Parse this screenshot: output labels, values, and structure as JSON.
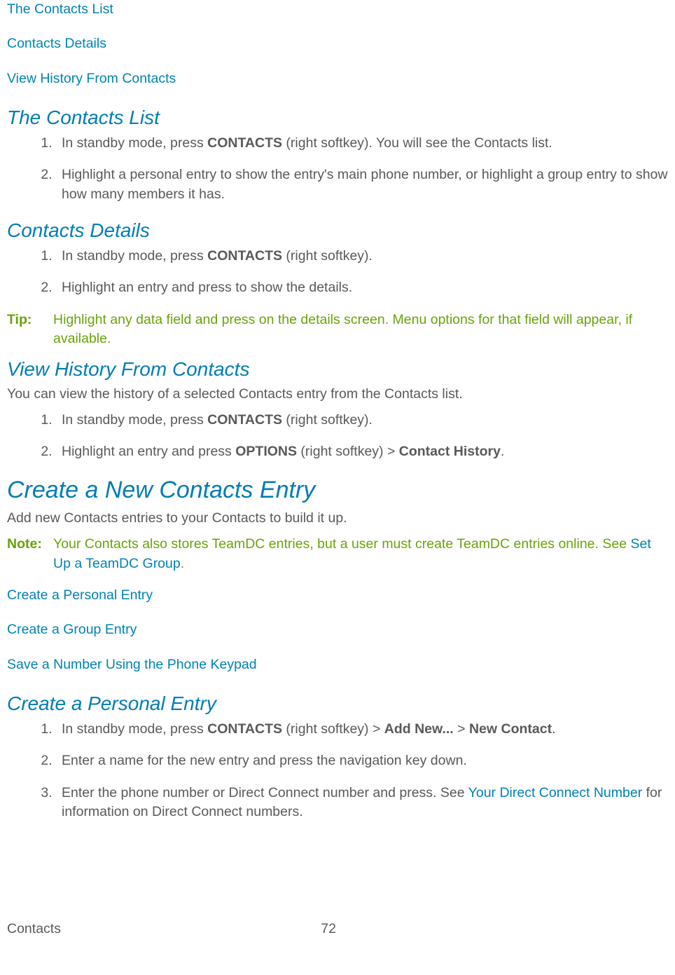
{
  "toc1": {
    "item1": "The Contacts List",
    "item2": "Contacts Details",
    "item3": "View History From Contacts"
  },
  "section1": {
    "heading": "The Contacts List",
    "li1_a": "In standby mode, press ",
    "li1_b": "CONTACTS",
    "li1_c": " (right softkey). You will see the Contacts list.",
    "li2": "Highlight a personal entry to show the entry's main phone number, or highlight a group entry to show how many members it has."
  },
  "section2": {
    "heading": "Contacts Details",
    "li1_a": "In standby mode, press ",
    "li1_b": "CONTACTS",
    "li1_c": " (right softkey).",
    "li2": "Highlight an entry and press  to show the details."
  },
  "tip": {
    "label": "Tip:",
    "text": "Highlight any data field and press  on the details screen. Menu options for that field will appear, if available."
  },
  "section3": {
    "heading": "View History From Contacts",
    "intro": "You can view the history of a selected Contacts entry from the Contacts list.",
    "li1_a": "In standby mode, press ",
    "li1_b": "CONTACTS",
    "li1_c": " (right softkey).",
    "li2_a": "Highlight an entry and press ",
    "li2_b": "OPTIONS",
    "li2_c": " (right softkey) > ",
    "li2_d": "Contact History",
    "li2_e": "."
  },
  "section4": {
    "heading": "Create a New Contacts Entry",
    "intro": "Add new Contacts entries to your Contacts to build it up."
  },
  "note": {
    "label": "Note:",
    "text_a": "Your Contacts also stores TeamDC entries, but a user must create TeamDC entries online. See ",
    "text_link": "Set Up a TeamDC Group",
    "text_b": "."
  },
  "toc2": {
    "item1": "Create a Personal Entry",
    "item2": "Create a Group Entry",
    "item3": "Save a Number Using the Phone Keypad"
  },
  "section5": {
    "heading": "Create a Personal Entry",
    "li1_a": "In standby mode, press ",
    "li1_b": "CONTACTS",
    "li1_c": " (right softkey) > ",
    "li1_d": "Add New...",
    "li1_e": " > ",
    "li1_f": "New Contact",
    "li1_g": ".",
    "li2": "Enter a name for the new entry and press the navigation key down.",
    "li3_a": "Enter the phone number or Direct Connect number and press. See ",
    "li3_link": "Your Direct Connect Number",
    "li3_b": " for information on Direct Connect numbers."
  },
  "footer": {
    "section": "Contacts",
    "page": "72"
  }
}
